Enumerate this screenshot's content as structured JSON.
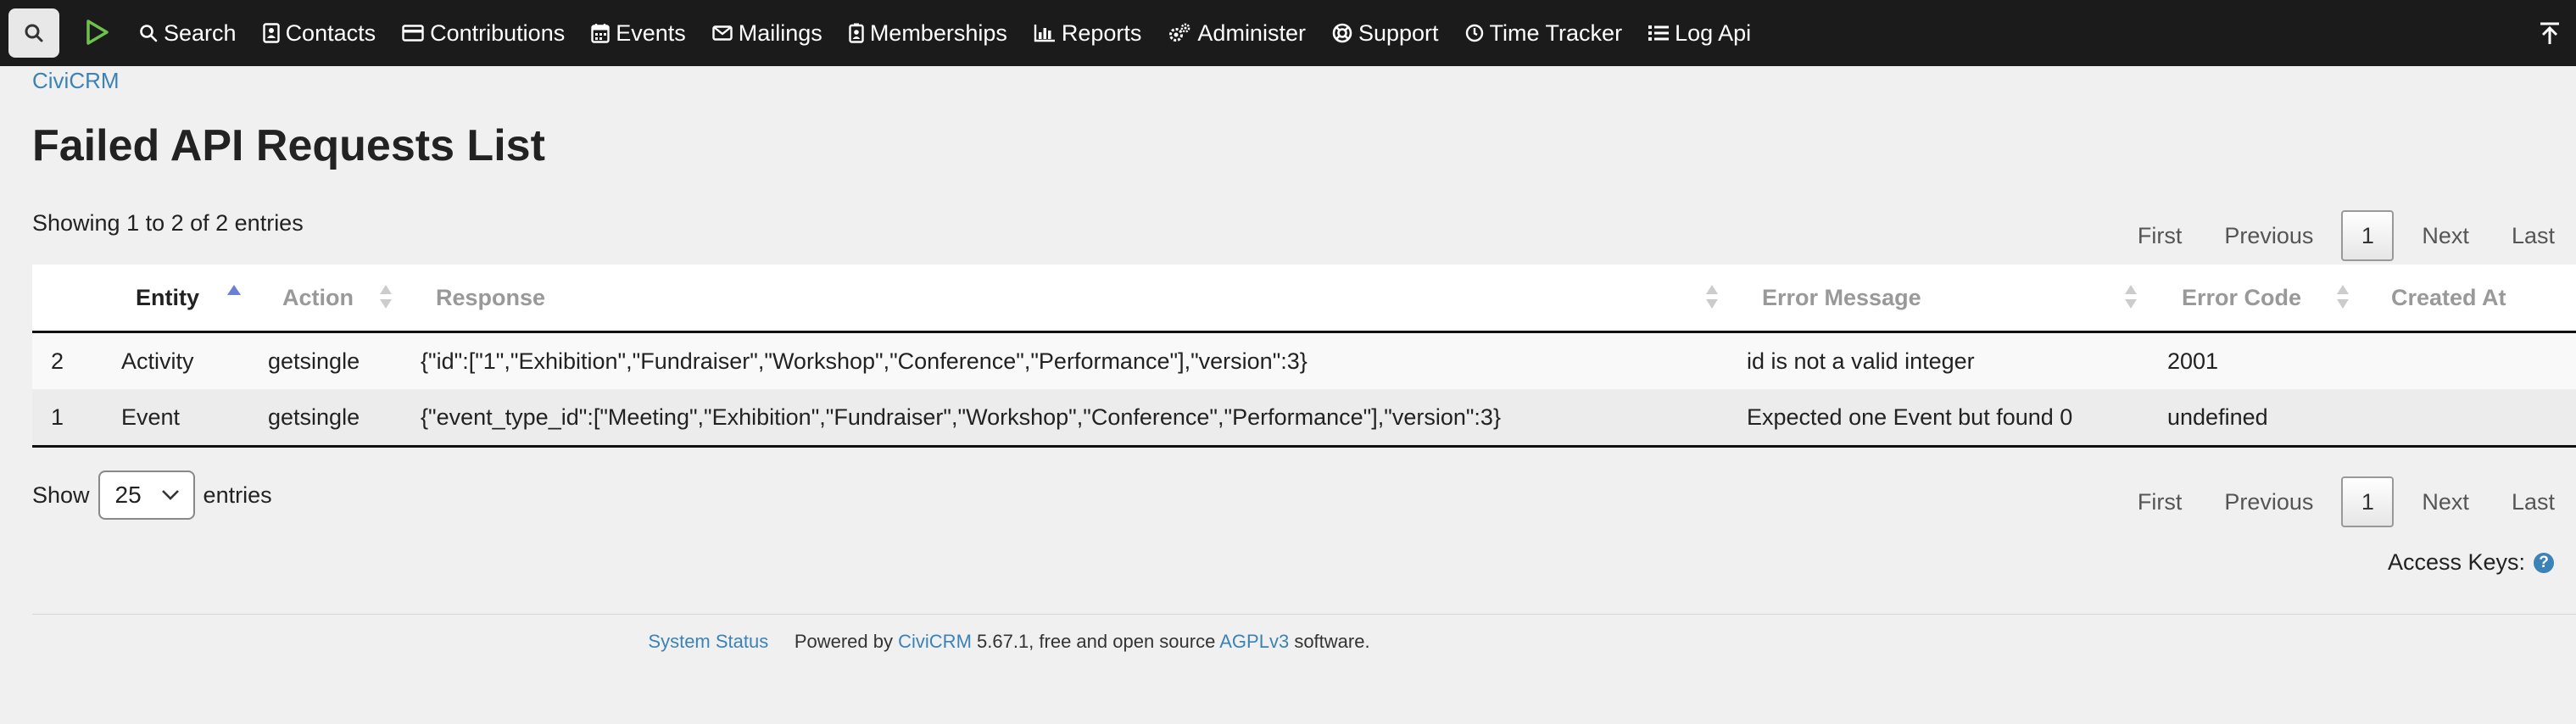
{
  "menu": {
    "items": [
      {
        "label": "Search",
        "icon": "search-icon"
      },
      {
        "label": "Contacts",
        "icon": "contact-card-icon"
      },
      {
        "label": "Contributions",
        "icon": "credit-card-icon"
      },
      {
        "label": "Events",
        "icon": "calendar-icon"
      },
      {
        "label": "Mailings",
        "icon": "envelope-icon"
      },
      {
        "label": "Memberships",
        "icon": "id-badge-icon"
      },
      {
        "label": "Reports",
        "icon": "bar-chart-icon"
      },
      {
        "label": "Administer",
        "icon": "cogs-icon"
      },
      {
        "label": "Support",
        "icon": "life-ring-icon"
      },
      {
        "label": "Time Tracker",
        "icon": "clock-icon"
      },
      {
        "label": "Log Api",
        "icon": "list-icon"
      }
    ]
  },
  "breadcrumb": "CiviCRM",
  "page_title": "Failed API Requests List",
  "showing_text": "Showing 1 to 2 of 2 entries",
  "pager": {
    "first": "First",
    "previous": "Previous",
    "current": "1",
    "next": "Next",
    "last": "Last"
  },
  "table": {
    "columns": [
      "",
      "Entity",
      "Action",
      "Response",
      "Error Message",
      "Error Code",
      "Created At"
    ],
    "rows": [
      [
        "2",
        "Activity",
        "getsingle",
        "{\"id\":[\"1\",\"Exhibition\",\"Fundraiser\",\"Workshop\",\"Conference\",\"Performance\"],\"version\":3}",
        "id is not a valid integer",
        "2001",
        ""
      ],
      [
        "1",
        "Event",
        "getsingle",
        "{\"event_type_id\":[\"Meeting\",\"Exhibition\",\"Fundraiser\",\"Workshop\",\"Conference\",\"Performance\"],\"version\":3}",
        "Expected one Event but found 0",
        "undefined",
        ""
      ]
    ]
  },
  "length": {
    "show_label": "Show",
    "value": "25",
    "entries_label": "entries"
  },
  "access_keys": {
    "label": "Access Keys:",
    "help": "?"
  },
  "footer": {
    "system_status": "System Status",
    "powered_by": "Powered by",
    "civicrm": "CiviCRM",
    "version_text": "5.67.1, free and open source",
    "license": "AGPLv3",
    "software": "software."
  },
  "colors": {
    "menubar": "#1b1b1b",
    "link": "#3b82b6",
    "background": "#f0f0f0",
    "sort_active": "#6b7fd6"
  }
}
